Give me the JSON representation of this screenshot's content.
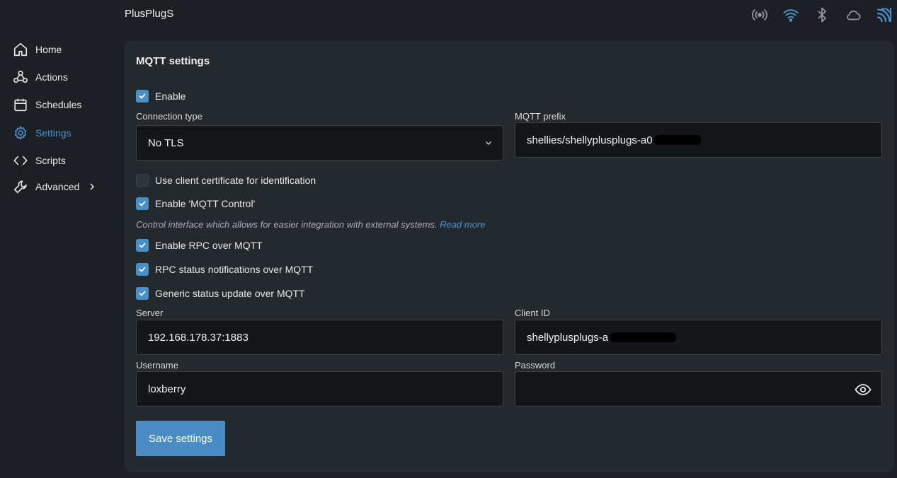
{
  "header": {
    "title": "PlusPlugS",
    "icons": [
      "broadcast-icon",
      "wifi-icon",
      "bluetooth-icon",
      "cloud-icon",
      "mqtt-feed-icon"
    ]
  },
  "sidebar": {
    "items": [
      {
        "label": "Home",
        "icon": "home-icon"
      },
      {
        "label": "Actions",
        "icon": "webhook-icon"
      },
      {
        "label": "Schedules",
        "icon": "calendar-icon"
      },
      {
        "label": "Settings",
        "icon": "gear-icon",
        "active": true
      },
      {
        "label": "Scripts",
        "icon": "code-icon"
      },
      {
        "label": "Advanced",
        "icon": "wrench-icon"
      }
    ]
  },
  "mqtt": {
    "title": "MQTT settings",
    "enable_label": "Enable",
    "enable_checked": true,
    "connection_type_label": "Connection type",
    "connection_type_value": "No TLS",
    "prefix_label": "MQTT prefix",
    "prefix_value": "shellies/shellyplusplugs-a0",
    "client_cert_label": "Use client certificate for identification",
    "client_cert_checked": false,
    "mqtt_control_label": "Enable 'MQTT Control'",
    "mqtt_control_checked": true,
    "hint_text": "Control interface which allows for easier integration with external systems.",
    "hint_link": "Read more",
    "rpc_label": "Enable RPC over MQTT",
    "rpc_checked": true,
    "rpc_status_label": "RPC status notifications over MQTT",
    "rpc_status_checked": true,
    "generic_status_label": "Generic status update over MQTT",
    "generic_status_checked": true,
    "server_label": "Server",
    "server_value": "192.168.178.37:1883",
    "client_id_label": "Client ID",
    "client_id_value": "shellyplusplugs-a",
    "username_label": "Username",
    "username_value": "loxberry",
    "password_label": "Password",
    "password_value": "",
    "save_label": "Save settings"
  },
  "colors": {
    "accent": "#4a90c8",
    "background": "#1c2025",
    "panel": "#24292e",
    "field": "#14171a"
  }
}
